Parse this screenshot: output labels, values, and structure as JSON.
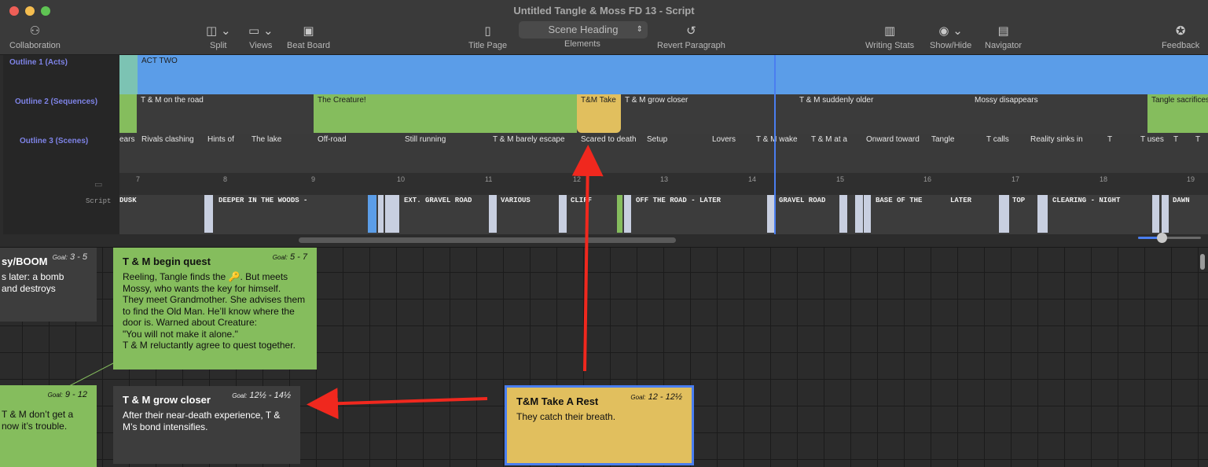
{
  "window": {
    "title": "Untitled Tangle & Moss FD 13 - Script"
  },
  "toolbar": {
    "collaboration": "Collaboration",
    "split": "Split",
    "views": "Views",
    "beat_board": "Beat Board",
    "title_page": "Title Page",
    "elements": "Elements",
    "element_value": "Scene Heading",
    "revert_paragraph": "Revert Paragraph",
    "writing_stats": "Writing Stats",
    "show_hide": "Show/Hide",
    "navigator": "Navigator",
    "feedback": "Feedback"
  },
  "timeline": {
    "rows": {
      "outline1": "Outline 1 (Acts)",
      "outline2": "Outline 2 (Sequences)",
      "outline3": "Outline 3 (Scenes)",
      "script": "Script"
    },
    "acts": [
      "ACT TWO"
    ],
    "sequences": [
      "T & M on the road",
      "The Creature!",
      "T&M Take",
      "T & M grow closer",
      "T & M suddenly older",
      "Mossy disappears",
      "Tangle sacrifices"
    ],
    "scenes": [
      "ears",
      "Rivals clashing",
      "Hints of",
      "The lake",
      "Off-road",
      "Still running",
      "T & M barely escape",
      "Scared to death",
      "Setup",
      "Lovers",
      "T & M wake",
      "T & M at a",
      "Onward toward",
      "Tangle",
      "T calls",
      "Reality sinks in",
      "T",
      "T uses",
      "T",
      "T"
    ],
    "ruler": [
      "7",
      "8",
      "9",
      "10",
      "11",
      "12",
      "13",
      "14",
      "15",
      "16",
      "17",
      "18",
      "19"
    ],
    "script_headings": [
      "DUSK",
      "DEEPER IN THE WOODS -",
      "EXT. GRAVEL ROAD",
      "VARIOUS",
      "CLIFF",
      "OFF THE ROAD - LATER",
      "GRAVEL ROAD",
      "BASE OF THE",
      "LATER",
      "TOP",
      "CLEARING - NIGHT",
      "DAWN"
    ]
  },
  "cards": [
    {
      "title": "sy/BOOM",
      "goal": "3 - 5",
      "body": "s later: a bomb\nand destroys"
    },
    {
      "title": "T & M begin quest",
      "goal": "5 - 7",
      "body": "Reeling, Tangle finds the 🔑. But meets\nMossy, who wants the key for himself.\nThey meet Grandmother. She advises them\nto find the Old Man. He’ll know where the\ndoor is. Warned about Creature:\n\"You will not make it alone.\"\nT & M reluctantly agree to quest together."
    },
    {
      "title": "",
      "goal": "9 - 12",
      "body": "T & M don’t get a\nnow it’s trouble."
    },
    {
      "title": "T & M grow closer",
      "goal": "12½ - 14½",
      "body": "After their near-death experience, T &\nM’s bond intensifies."
    },
    {
      "title": "T&M Take A Rest",
      "goal": "12 - 12½",
      "body": "They catch their breath."
    }
  ],
  "goal_prefix": "Goal:",
  "colors": {
    "green": "#85bd5d",
    "blue": "#5b9de8",
    "yellow": "#e1bf5e",
    "dark_card": "#3d3d3d",
    "arrow": "#f0281e"
  }
}
